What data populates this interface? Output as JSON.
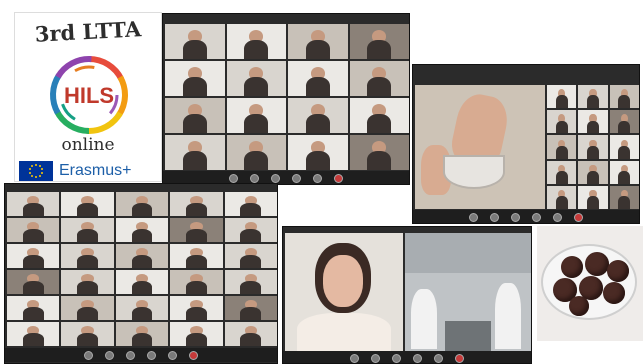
{
  "logo": {
    "title": "3rd LTTA",
    "acronym": "HILS",
    "subtitle": "online",
    "program": "Erasmus+"
  },
  "colors": {
    "erasmus_blue": "#1d5fa8",
    "eu_flag_blue": "#003399",
    "eu_star_yellow": "#ffcc00"
  },
  "icons": {
    "flag": "eu-flag-icon",
    "ring": "rainbow-ring-icon"
  }
}
